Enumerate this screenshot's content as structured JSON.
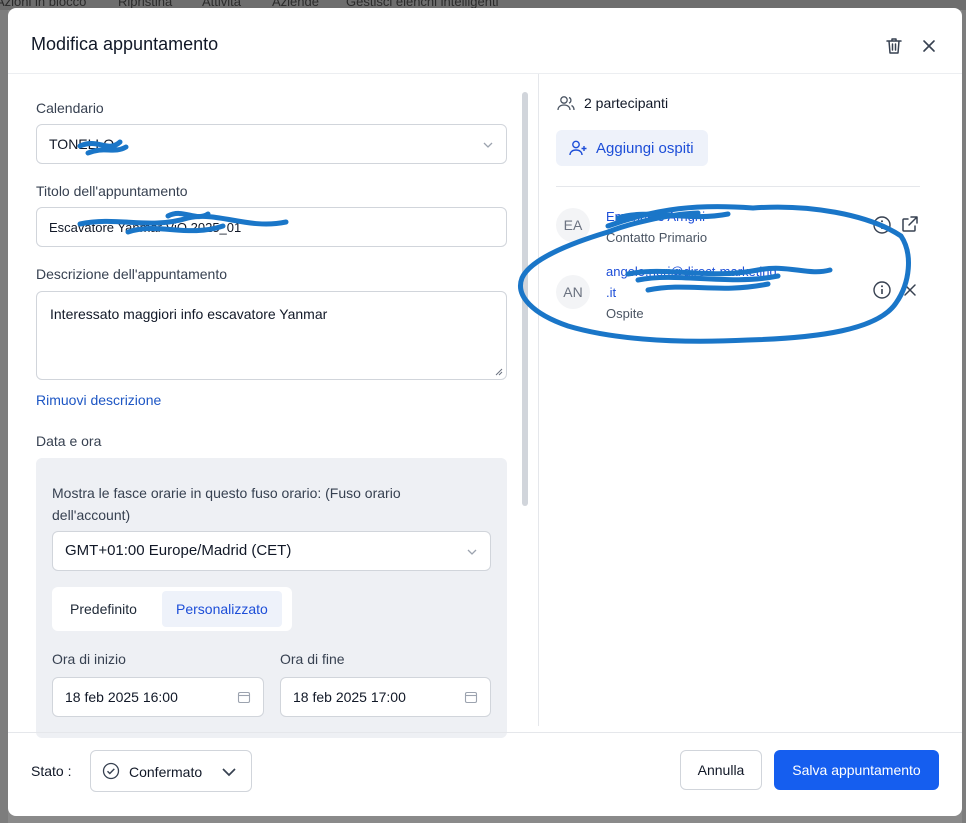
{
  "background": {
    "toolbar_items": [
      "Azioni in blocco",
      "Ripristina",
      "Attività",
      "Aziende",
      "Gestisci elenchi intelligenti"
    ]
  },
  "modal": {
    "title": "Modifica appuntamento",
    "icons": {
      "delete": "trash-icon",
      "close": "close-icon"
    }
  },
  "form": {
    "calendar": {
      "label": "Calendario",
      "value": "TONELLO"
    },
    "title": {
      "label": "Titolo dell'appuntamento",
      "value": "Escavatore Yanmar ViO 2025_01"
    },
    "description": {
      "label": "Descrizione dell'appuntamento",
      "value": "Interessato maggiori info escavatore Yanmar"
    },
    "remove_description": "Rimuovi descrizione",
    "datetime": {
      "label": "Data e ora",
      "timezone_note": "Mostra le fasce orarie in questo fuso orario: (Fuso orario dell'account)",
      "timezone_value": "GMT+01:00 Europe/Madrid (CET)",
      "modes": [
        "Predefinito",
        "Personalizzato"
      ],
      "selected_mode": "Personalizzato",
      "start": {
        "label": "Ora di inizio",
        "value": "18 feb 2025 16:00"
      },
      "end": {
        "label": "Ora di fine",
        "value": "18 feb 2025 17:00"
      }
    }
  },
  "participants": {
    "count_label": "2 partecipanti",
    "add_guests": "Aggiungi ospiti",
    "items": [
      {
        "initials": "EA",
        "name": "Emanuele Arrighi",
        "role": "Contatto Primario"
      },
      {
        "initials": "AN",
        "name": "angelo.neri@direct-marketing",
        "name_line2": ".it",
        "role": "Ospite"
      }
    ]
  },
  "footer": {
    "status_label": "Stato :",
    "status_value": "Confermato",
    "cancel": "Annulla",
    "save": "Salva appuntamento"
  },
  "colors": {
    "primary": "#155eef",
    "link": "#1d56c4",
    "scribble": "#1a76c8"
  }
}
